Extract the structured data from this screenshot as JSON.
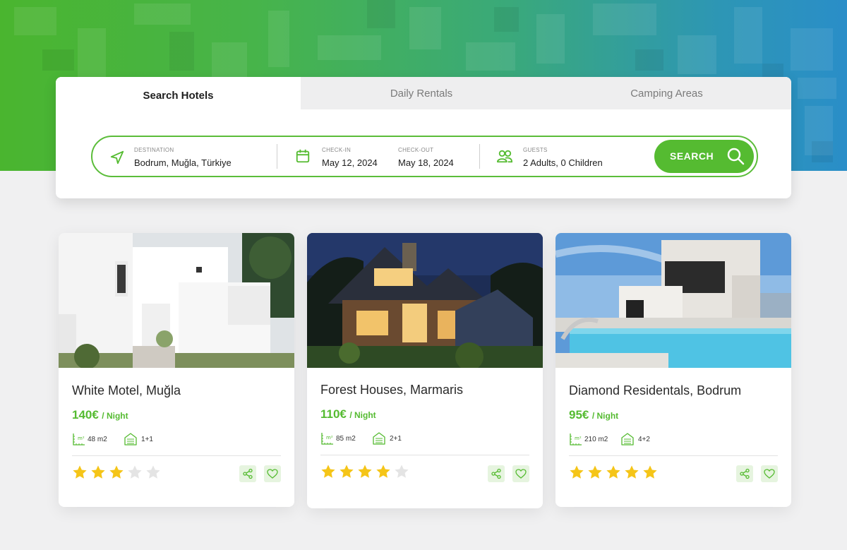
{
  "colors": {
    "accent": "#55bb31",
    "star_filled": "#f5c518",
    "star_empty": "#e4e4e4"
  },
  "tabs": [
    {
      "label": "Search Hotels",
      "active": true
    },
    {
      "label": "Daily Rentals",
      "active": false
    },
    {
      "label": "Camping Areas",
      "active": false
    }
  ],
  "search": {
    "destination": {
      "label": "DESTINATION",
      "value": "Bodrum, Muğla, Türkiye",
      "icon": "navigation-arrow-icon"
    },
    "checkin": {
      "label": "CHECK-IN",
      "value": "May 12, 2024",
      "icon": "calendar-icon"
    },
    "checkout": {
      "label": "CHECK-OUT",
      "value": "May 18, 2024"
    },
    "guests": {
      "label": "GUESTS",
      "value": "2 Adults, 0 Children",
      "icon": "users-icon"
    },
    "button_label": "SEARCH"
  },
  "listings": [
    {
      "title": "White Motel, Muğla",
      "price": "140€",
      "per": "/ Night",
      "area": "48 m2",
      "rooms": "1+1",
      "rating": 3,
      "photo": "white modern house"
    },
    {
      "title": "Forest Houses, Marmaris",
      "price": "110€",
      "per": "/ Night",
      "area": "85 m2",
      "rooms": "2+1",
      "rating": 4,
      "photo": "wooden house at dusk"
    },
    {
      "title": "Diamond Residentals, Bodrum",
      "price": "95€",
      "per": "/ Night",
      "area": "210 m2",
      "rooms": "4+2",
      "rating": 5,
      "photo": "villa with pool"
    }
  ]
}
